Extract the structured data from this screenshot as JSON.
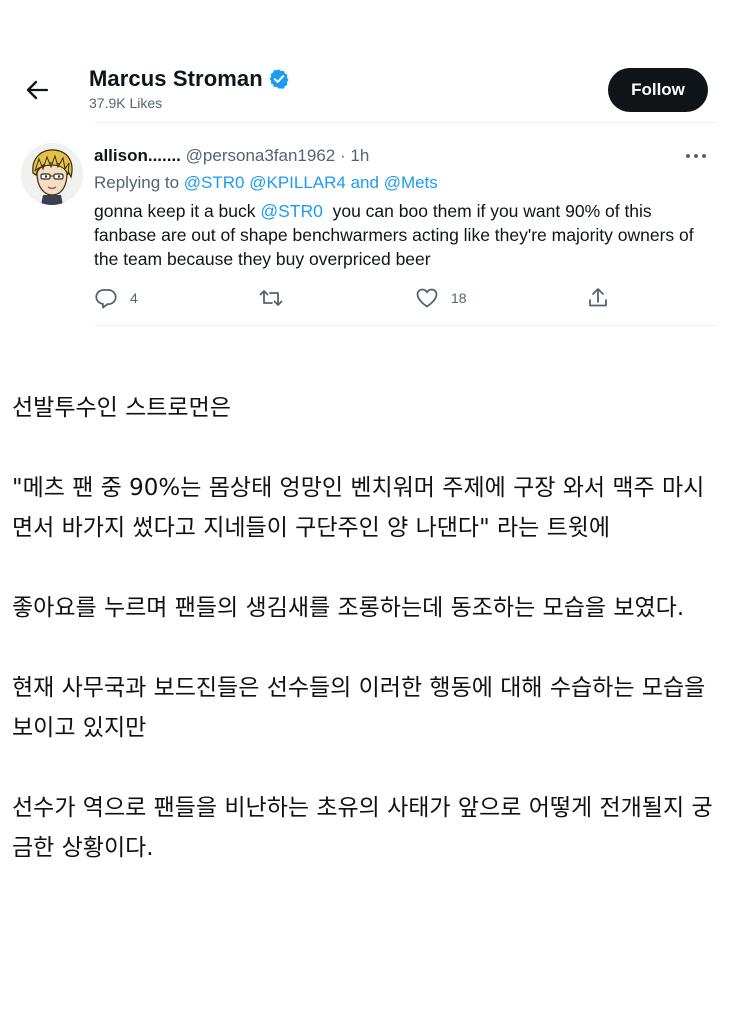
{
  "header": {
    "profile_name": "Marcus Stroman",
    "likes_count": "37.9K Likes",
    "follow_label": "Follow"
  },
  "tweet": {
    "author_name": "allison.......",
    "author_handle": "@persona3fan1962",
    "time_sep": " · ",
    "time": "1h",
    "replying_prefix": "Replying to ",
    "mention_1": "@STR0",
    "mention_2": "@KPILLAR4",
    "replying_and": " and ",
    "mention_3": "@Mets",
    "text_before": "gonna keep it a buck ",
    "text_mention": "@STR0",
    "text_after": "  you can boo them if you want 90% of this fanbase are out of shape benchwarmers acting like they're majority owners of the team because they buy overpriced beer",
    "reply_count": "4",
    "like_count": "18"
  },
  "article": {
    "p1": "선발투수인 스트로먼은",
    "p2": "\"메츠 팬 중 90%는 몸상태 엉망인 벤치워머 주제에 구장 와서 맥주 마시면서 바가지 썼다고 지네들이 구단주인 양 나댄다\" 라는 트윗에",
    "p3": "좋아요를 누르며 팬들의 생김새를 조롱하는데 동조하는 모습을 보였다.",
    "p4": "현재 사무국과 보드진들은 선수들의 이러한 행동에 대해 수습하는 모습을 보이고 있지만",
    "p5": "선수가 역으로 팬들을 비난하는 초유의 사태가 앞으로 어떻게 전개될지 궁금한 상황이다."
  },
  "icons": {
    "back": "back-arrow-icon",
    "verified": "verified-badge-icon",
    "more": "more-icon",
    "reply": "reply-icon",
    "retweet": "retweet-icon",
    "like": "heart-icon",
    "share": "share-icon"
  },
  "colors": {
    "link": "#1d9bf0",
    "secondary_text": "#536471",
    "follow_bg": "#0f1419"
  }
}
